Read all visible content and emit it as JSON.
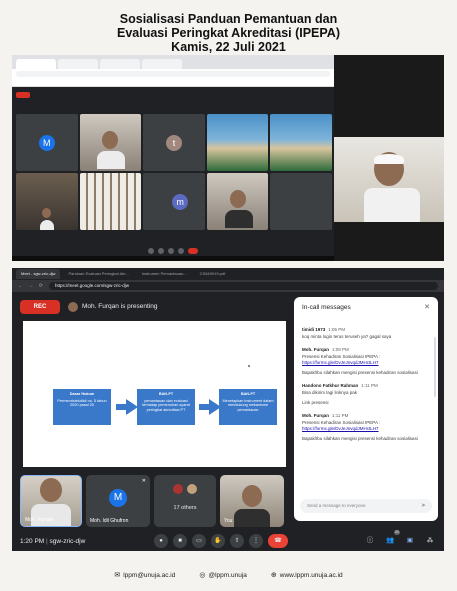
{
  "header": {
    "title_line1": "Sosialisasi Panduan Pemantuan dan",
    "title_line2": "Evaluasi Peringkat Akreditasi (IPEPA)",
    "date_line": "Kamis, 22 Juli 2021"
  },
  "meet": {
    "tabs": [
      "Meet - sgw-zric-djw",
      "Panduan Evaluasi Peringkat Akr...",
      "Instrumen Pemantauan...",
      "CS649919.pdf"
    ],
    "url": "https://meet.google.com/sgw-zric-djw",
    "rec_label": "REC",
    "presenting": "Moh. Furqan is presenting",
    "slide": {
      "box1_title": "Dasar Hukum",
      "box1_text": "Permenristekdikti no. 5 tahun 2020 pasal 25",
      "box2_title": "BAN-PT",
      "box2_text": "pemantauan dan evaluasi terhadap pemenuhan syarat peringkat akreditasi PT",
      "box3_title": "BAN-PT",
      "box3_text": "Menetapkan instrument dalam mendukung mekanisme pemantauan"
    },
    "participants": {
      "tile1": "Moh. Furqan",
      "tile2": "Moh. Idil Ghufron",
      "tile2_initial": "M",
      "tile3": "17 others",
      "tile4": "You"
    },
    "time": "1:20 PM",
    "meeting_code": "sgw-zric-djw",
    "participant_badge": "21"
  },
  "chat": {
    "title": "In-call messages",
    "messages": [
      {
        "sender": "timidi 1973",
        "time": "1:06 PM",
        "lines": [
          "koq minta login terus teruseh ya? gagal saya"
        ]
      },
      {
        "sender": "Moh. Furqan",
        "time": "1:09 PM",
        "lines": [
          "Presensi Kehadiran Sosialisasi IPEPA :"
        ],
        "link": "https://forms.gle/DvJeJnvqdJMHctLH7",
        "after": [
          "Bapak/Ibu silahkan mengisi presensi kehadiran sosialisasi"
        ]
      },
      {
        "sender": "Handono Fatkhur Rahman",
        "time": "1:11 PM",
        "lines": [
          "Bisa dikirim lagi linknya pak",
          "Link presensi"
        ]
      },
      {
        "sender": "Moh. Furqan",
        "time": "1:11 PM",
        "lines": [
          "Presensi Kehadiran Sosialisasi IPEPA :"
        ],
        "link": "https://forms.gle/DvJeJnvqdJMHctLH7",
        "after": [
          "Bapak/Ibu silahkan mengisi presensi kehadiran sosialisasi"
        ]
      }
    ],
    "input_placeholder": "Send a message to everyone"
  },
  "footer": {
    "email": "lppm@unuja.ac.id",
    "social": "@lppm.unuja",
    "website": "www.lppm.unuja.ac.id"
  },
  "icons": [
    "mic-icon",
    "camera-icon",
    "captions-icon",
    "hand-icon",
    "present-icon",
    "more-icon",
    "end-call-icon",
    "info-icon",
    "people-icon",
    "chat-icon",
    "activities-icon",
    "close-icon",
    "send-icon",
    "mail-icon",
    "instagram-icon",
    "globe-icon"
  ],
  "colors": {
    "rec_red": "#d93025",
    "slide_blue": "#3a78c9",
    "end_call": "#ea4335",
    "link": "#1a0dab"
  }
}
